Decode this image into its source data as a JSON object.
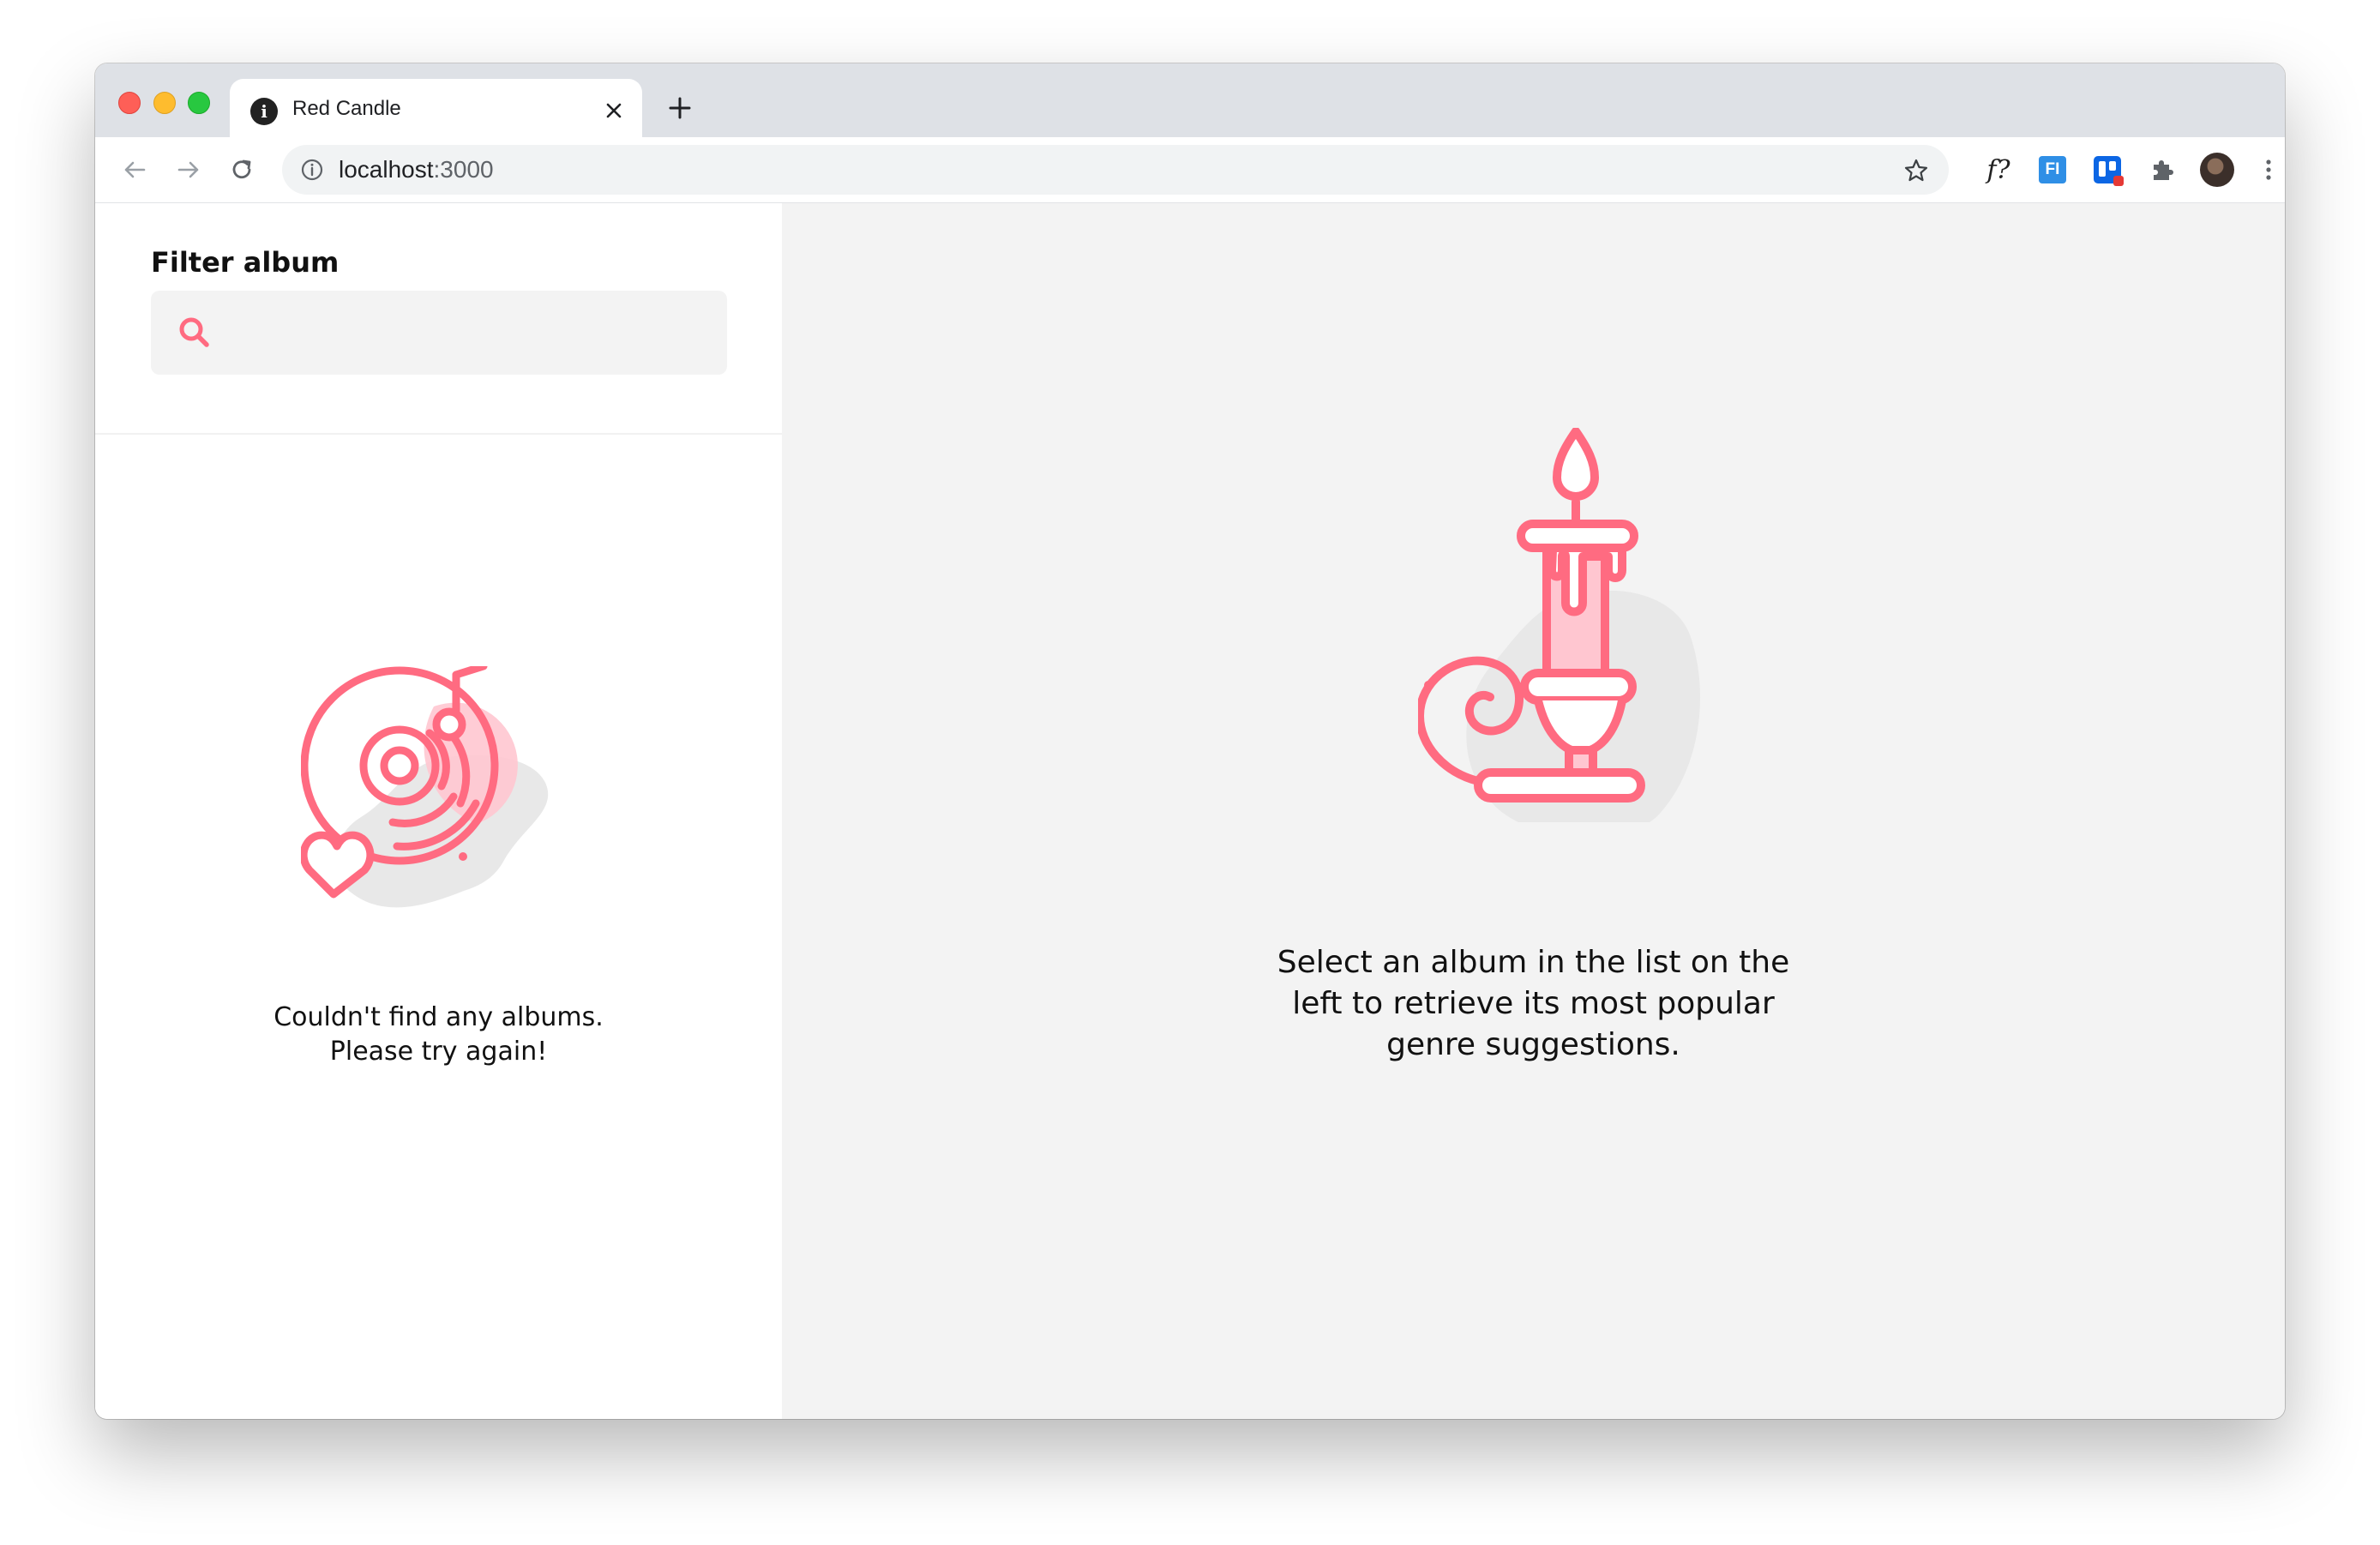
{
  "browser": {
    "tab": {
      "title": "Red Candle",
      "favicon": "info-favicon-icon",
      "close_icon": "close-icon"
    },
    "new_tab_icon": "plus-icon",
    "nav": {
      "back_icon": "arrow-left-icon",
      "forward_icon": "arrow-right-icon",
      "reload_icon": "reload-icon"
    },
    "address_bar": {
      "host": "localhost",
      "port": ":3000",
      "info_icon": "info-icon",
      "bookmark_icon": "star-icon"
    },
    "extensions": [
      {
        "name": "font-identifier-extension",
        "label": "f?"
      },
      {
        "name": "fi-extension",
        "label": "FI"
      },
      {
        "name": "trello-extension",
        "label": ""
      },
      {
        "name": "extensions-puzzle",
        "label": ""
      }
    ],
    "menu_icon": "kebab-menu-icon"
  },
  "sidebar": {
    "filter_label": "Filter album",
    "search": {
      "icon": "search-icon",
      "placeholder": "",
      "value": ""
    },
    "empty_state": {
      "illustration": "vinyl-record-heart-illustration",
      "line1": "Couldn't find any albums.",
      "line2": "Please try again!"
    }
  },
  "main": {
    "illustration": "candle-illustration",
    "message_line1": "Select an album in the list on the",
    "message_line2": "left to retrieve its most popular",
    "message_line3": "genre suggestions."
  },
  "colors": {
    "accent": "#ff6b81",
    "accent_light": "#ffc6d0",
    "blob": "#e8e8e8",
    "main_bg": "#f3f3f3",
    "input_bg": "#f3f3f3"
  }
}
